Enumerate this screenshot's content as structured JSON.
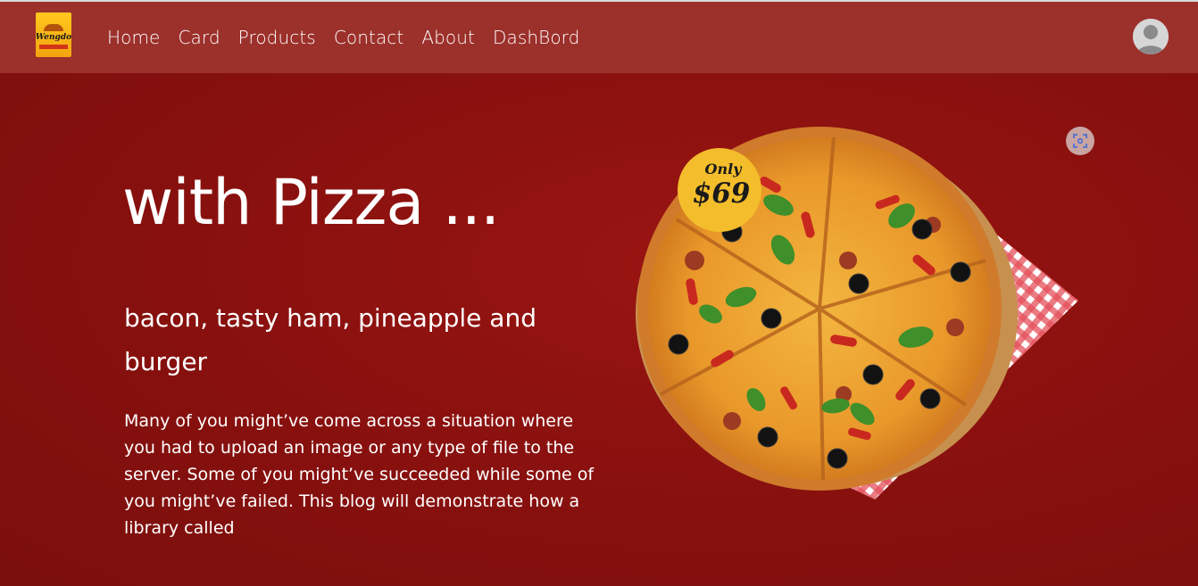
{
  "brand": {
    "logo_text": "Wengdo"
  },
  "nav": {
    "items": [
      {
        "label": "Home"
      },
      {
        "label": "Card"
      },
      {
        "label": "Products"
      },
      {
        "label": "Contact"
      },
      {
        "label": "About"
      },
      {
        "label": "DashBord"
      }
    ]
  },
  "hero": {
    "title": "with Pizza ...",
    "subtitle": "bacon, tasty ham, pineapple and burger",
    "description": "Many of you might’ve come across a situation where you had to upload an image or any type of file to the server. Some of you might’ve succeeded while some of you might’ve failed. This blog will demonstrate how a library called"
  },
  "promo": {
    "badge_top": "Only",
    "badge_price": "$69"
  },
  "icons": {
    "avatar": "user-avatar-icon",
    "scan": "scan-focus-icon"
  },
  "colors": {
    "background": "#8a110f",
    "navbar": "#9c302b",
    "badge": "#f4bd2b",
    "text": "#ffffff"
  }
}
